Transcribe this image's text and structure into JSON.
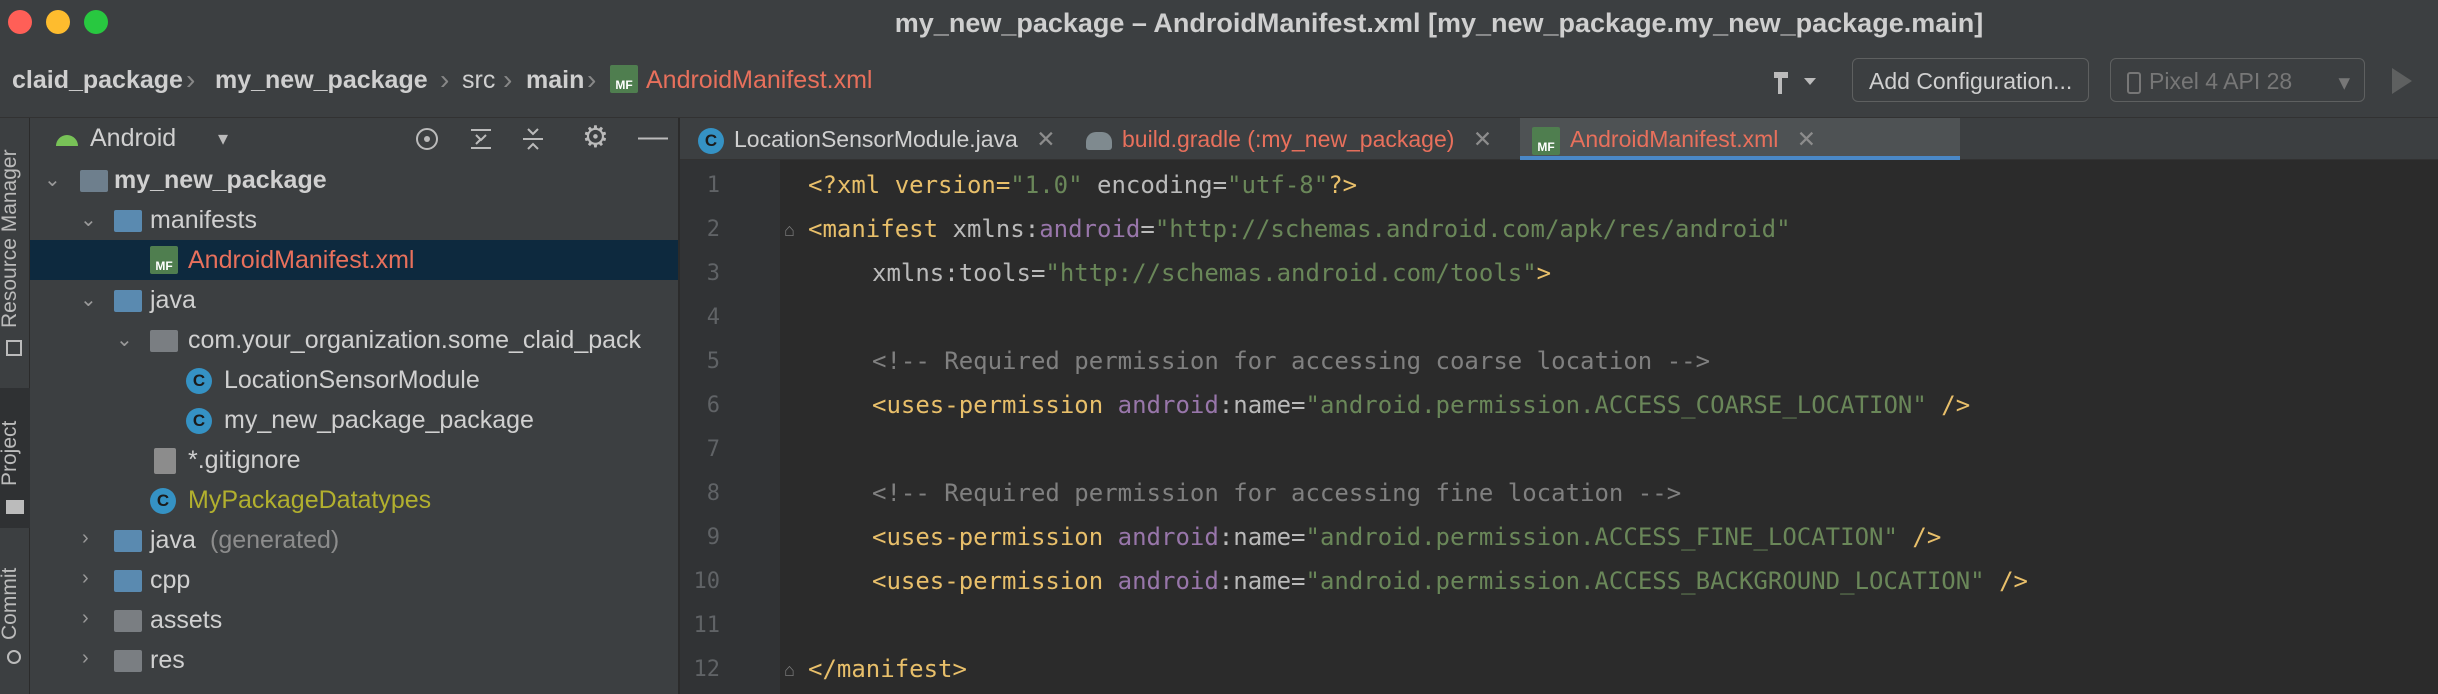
{
  "window": {
    "title": "my_new_package – AndroidManifest.xml [my_new_package.my_new_package.main]"
  },
  "breadcrumb": [
    "claid_package",
    "my_new_package",
    "src",
    "main",
    "AndroidManifest.xml"
  ],
  "toolbar": {
    "add_config": "Add Configuration...",
    "device": "Pixel 4 API 28"
  },
  "side_tabs": {
    "resource_manager": "Resource Manager",
    "project": "Project",
    "commit": "Commit"
  },
  "project": {
    "view": "Android",
    "tree": [
      {
        "label": "my_new_package"
      },
      {
        "label": "manifests"
      },
      {
        "label": "AndroidManifest.xml"
      },
      {
        "label": "java"
      },
      {
        "label": "com.your_organization.some_claid_pack"
      },
      {
        "label": "LocationSensorModule"
      },
      {
        "label": "my_new_package_package"
      },
      {
        "label": "*.gitignore"
      },
      {
        "label": "MyPackageDatatypes"
      },
      {
        "label": "java",
        "suffix": "(generated)"
      },
      {
        "label": "cpp"
      },
      {
        "label": "assets"
      },
      {
        "label": "res"
      }
    ]
  },
  "tabs": [
    {
      "label": "LocationSensorModule.java",
      "color": "#bbbbbb"
    },
    {
      "label": "build.gradle (:my_new_package)",
      "color": "#e8705c"
    },
    {
      "label": "AndroidManifest.xml",
      "color": "#e8705c"
    }
  ],
  "icons": {
    "class": "C",
    "manifest": "MF"
  },
  "editor": {
    "line_numbers": [
      "1",
      "2",
      "3",
      "4",
      "5",
      "6",
      "7",
      "8",
      "9",
      "10",
      "11",
      "12"
    ]
  },
  "code": {
    "l1": [
      "<?xml version=",
      "\"1.0\"",
      " encoding=",
      "\"utf-8\"",
      "?>"
    ],
    "l2": [
      "<manifest ",
      "xmlns:",
      "android",
      "=",
      "\"http://schemas.android.com/apk/res/android\""
    ],
    "l3": [
      "xmlns:tools=",
      "\"http://schemas.android.com/tools\"",
      ">"
    ],
    "l5": "<!-- Required permission for accessing coarse location -->",
    "l6": [
      "<uses-permission ",
      "android",
      ":name=",
      "\"android.permission.ACCESS_COARSE_LOCATION\"",
      " />"
    ],
    "l8": "<!-- Required permission for accessing fine location -->",
    "l9": [
      "<uses-permission ",
      "android",
      ":name=",
      "\"android.permission.ACCESS_FINE_LOCATION\"",
      " />"
    ],
    "l10": [
      "<uses-permission ",
      "android",
      ":name=",
      "\"android.permission.ACCESS_BACKGROUND_LOCATION\"",
      " />"
    ],
    "l12": "</manifest>"
  }
}
